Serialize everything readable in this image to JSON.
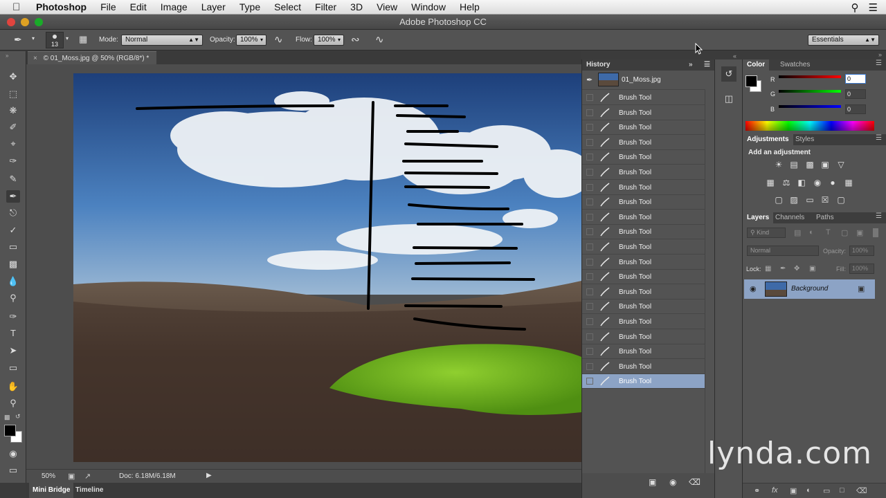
{
  "menubar": {
    "app_name": "Photoshop",
    "items": [
      "File",
      "Edit",
      "Image",
      "Layer",
      "Type",
      "Select",
      "Filter",
      "3D",
      "View",
      "Window",
      "Help"
    ]
  },
  "window": {
    "title": "Adobe Photoshop CC"
  },
  "options": {
    "brush_size": "13",
    "mode_label": "Mode:",
    "mode_value": "Normal",
    "opacity_label": "Opacity:",
    "opacity_value": "100%",
    "flow_label": "Flow:",
    "flow_value": "100%",
    "workspace": "Essentials"
  },
  "document": {
    "tab_title": "01_Moss.jpg @ 50% (RGB/8*) *",
    "zoom": "50%",
    "doc_size": "Doc: 6.18M/6.18M"
  },
  "bottom_tabs": [
    "Mini Bridge",
    "Timeline"
  ],
  "history": {
    "title": "History",
    "snapshot": "01_Moss.jpg",
    "states": [
      "Brush Tool",
      "Brush Tool",
      "Brush Tool",
      "Brush Tool",
      "Brush Tool",
      "Brush Tool",
      "Brush Tool",
      "Brush Tool",
      "Brush Tool",
      "Brush Tool",
      "Brush Tool",
      "Brush Tool",
      "Brush Tool",
      "Brush Tool",
      "Brush Tool",
      "Brush Tool",
      "Brush Tool",
      "Brush Tool",
      "Brush Tool",
      "Brush Tool"
    ],
    "selected_index": 19
  },
  "color_panel": {
    "tabs": [
      "Color",
      "Swatches"
    ],
    "r_label": "R",
    "g_label": "G",
    "b_label": "B",
    "r": "0",
    "g": "0",
    "b": "0"
  },
  "adjustments": {
    "tabs": [
      "Adjustments",
      "Styles"
    ],
    "subtitle": "Add an adjustment"
  },
  "layers": {
    "tabs": [
      "Layers",
      "Channels",
      "Paths"
    ],
    "kind": "Kind",
    "blend_mode": "Normal",
    "opacity_label": "Opacity:",
    "opacity": "100%",
    "lock_label": "Lock:",
    "fill_label": "Fill:",
    "fill": "100%",
    "layer_name": "Background"
  },
  "watermark": "lynda.com",
  "colors": {
    "accent_selection": "#8ca3c5",
    "panel": "#535353"
  }
}
